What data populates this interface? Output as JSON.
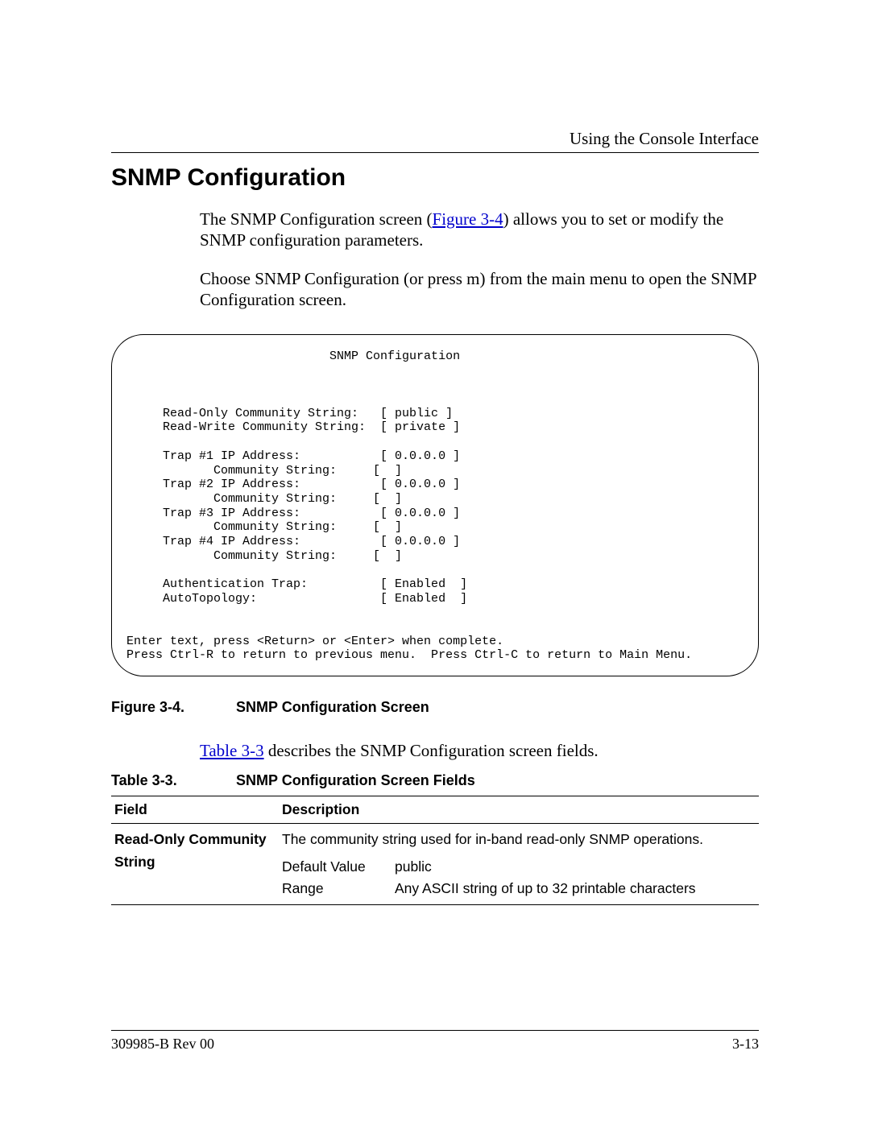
{
  "header": {
    "right": "Using the Console Interface"
  },
  "title": "SNMP Configuration",
  "para1": {
    "pre": "The SNMP Configuration screen (",
    "link": "Figure 3-4",
    "post": ") allows you to set or modify the SNMP configuration parameters."
  },
  "para2": "Choose SNMP Configuration (or press m) from the main menu to open the SNMP Configuration screen.",
  "screen": "                            SNMP Configuration\n\n\n\n     Read-Only Community String:   [ public ]\n     Read-Write Community String:  [ private ]\n\n     Trap #1 IP Address:           [ 0.0.0.0 ]\n            Community String:     [  ]\n     Trap #2 IP Address:           [ 0.0.0.0 ]\n            Community String:     [  ]\n     Trap #3 IP Address:           [ 0.0.0.0 ]\n            Community String:     [  ]\n     Trap #4 IP Address:           [ 0.0.0.0 ]\n            Community String:     [  ]\n\n     Authentication Trap:          [ Enabled  ]\n     AutoTopology:                 [ Enabled  ]\n\n\nEnter text, press <Return> or <Enter> when complete.\nPress Ctrl-R to return to previous menu.  Press Ctrl-C to return to Main Menu.",
  "fig_caption": {
    "label": "Figure 3-4.",
    "title": "SNMP Configuration Screen"
  },
  "para3": {
    "link": "Table 3-3",
    "post": " describes the SNMP Configuration screen fields."
  },
  "tbl_caption": {
    "label": "Table 3-3.",
    "title": "SNMP Configuration Screen Fields"
  },
  "table": {
    "headers": {
      "field": "Field",
      "desc": "Description"
    },
    "rows": [
      {
        "field": "Read-Only Community String",
        "desc_top": "The community string used for in-band read-only SNMP operations.",
        "default_label": "Default Value",
        "default_value": "public",
        "range_label": "Range",
        "range_value": "Any ASCII string of up to 32 printable characters"
      }
    ]
  },
  "footer": {
    "left": "309985-B Rev 00",
    "right": "3-13"
  }
}
